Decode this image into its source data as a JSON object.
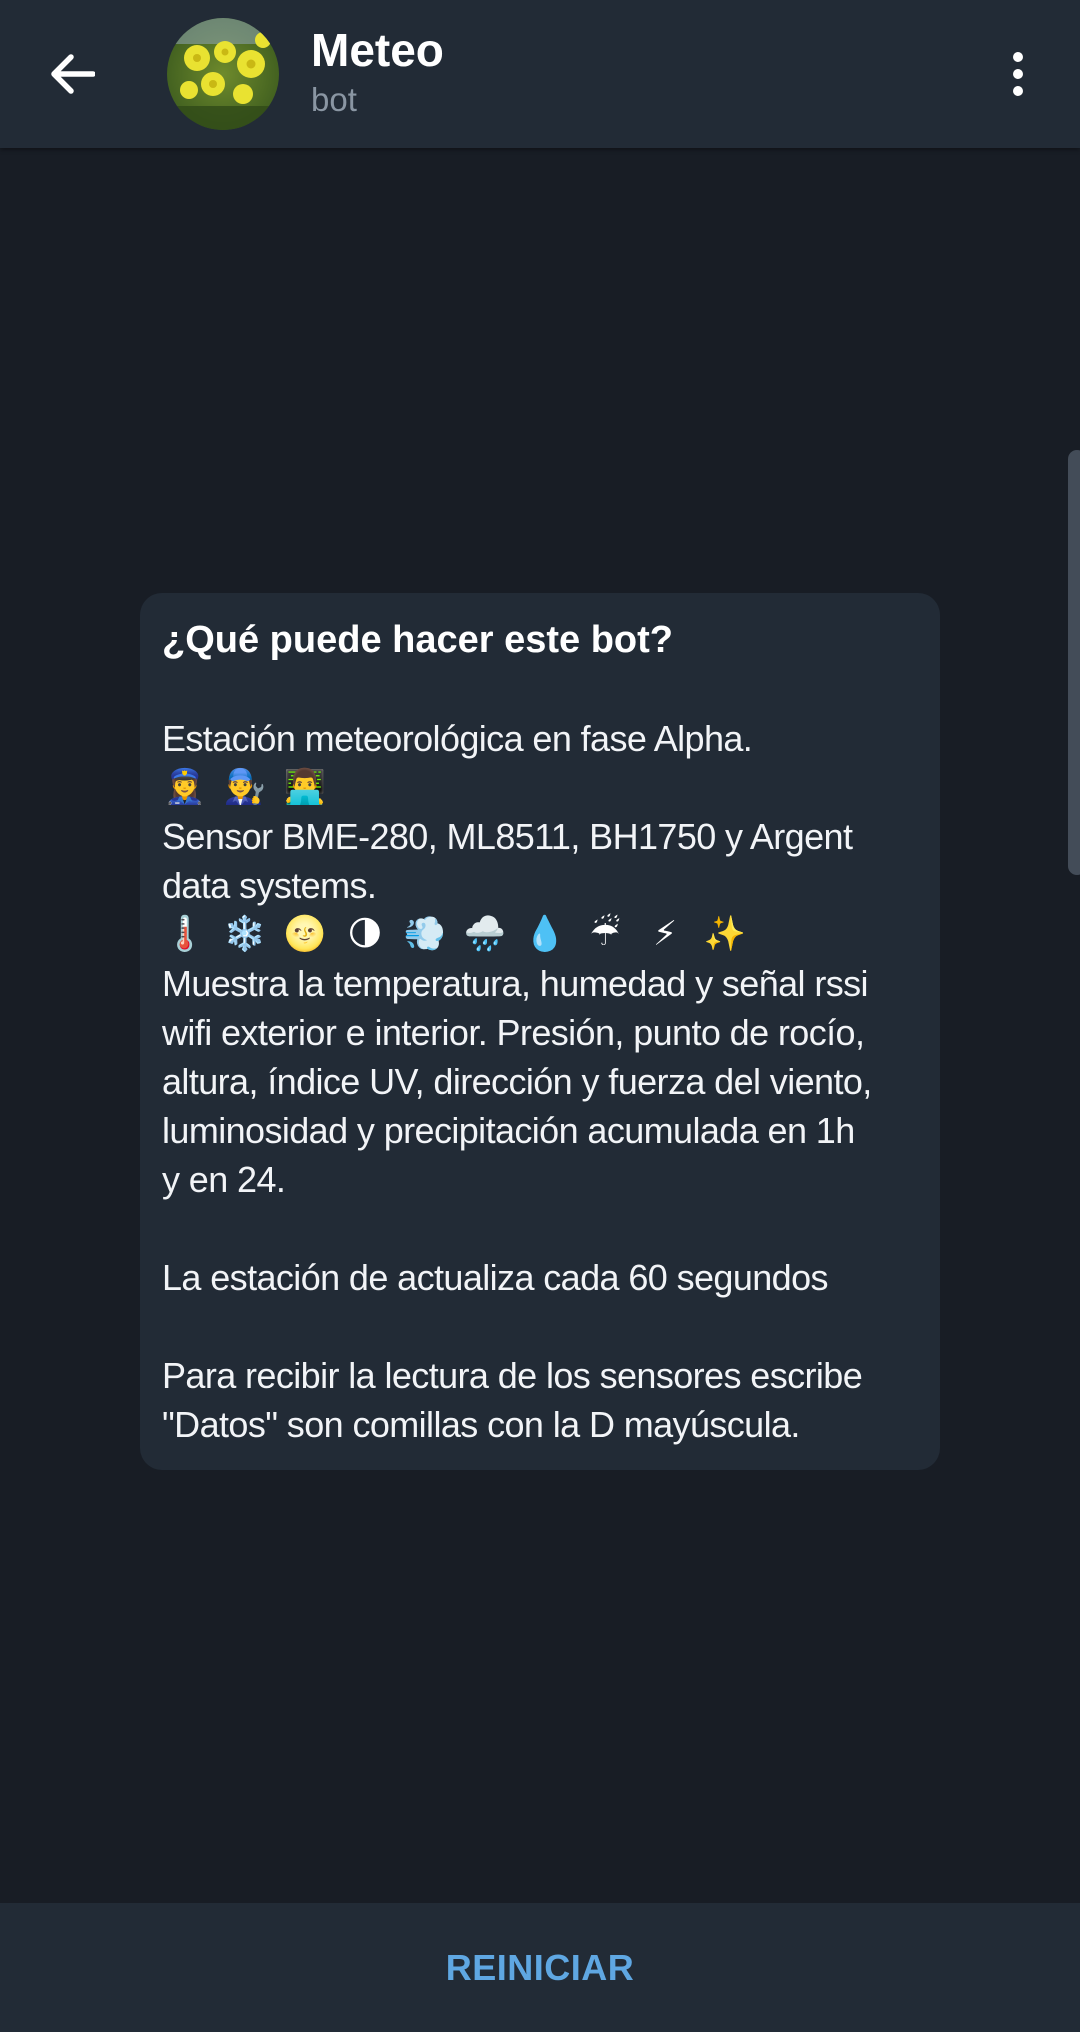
{
  "header": {
    "title": "Meteo",
    "subtitle": "bot",
    "back_icon": "arrow-left-icon",
    "menu_icon": "more-vertical-icon",
    "avatar": "yellow-flowers-photo"
  },
  "card": {
    "heading": "¿Qué puede hacer este bot?",
    "lines": [
      "Estación meteorológica en fase Alpha.",
      "Sensor BME-280, ML8511, BH1750 y Argent",
      "data systems.",
      "Muestra la temperatura, humedad y señal rssi",
      "wifi exterior e interior. Presión, punto de rocío,",
      "altura, índice UV, dirección y fuerza del viento,",
      "luminosidad y precipitación acumulada en 1h",
      "y en 24.",
      "La estación de actualiza cada 60 segundos",
      "Para recibir la lectura de los sensores escribe",
      "\"Datos\" son comillas con la D mayúscula."
    ],
    "emoji_row_1": [
      "👮‍♀️",
      "👨‍🔧",
      "👨‍💻"
    ],
    "emoji_row_2": [
      "🌡️",
      "❄️",
      "🌝",
      "🌗",
      "💨",
      "🌧️",
      "💧",
      "☔",
      "⚡",
      "✨"
    ]
  },
  "bottom": {
    "restart_label": "REINICIAR"
  },
  "colors": {
    "background": "#181d25",
    "bar": "#222b36",
    "accent": "#5fa7e2",
    "subtitle": "#8a96a3"
  }
}
